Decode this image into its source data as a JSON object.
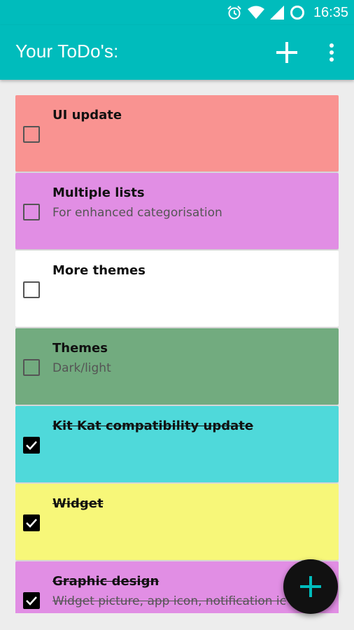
{
  "colors": {
    "primary": "#00bcbc",
    "background": "#ededed",
    "fab": "#111111",
    "fab_icon": "#00bcbc"
  },
  "status_bar": {
    "icons": [
      "alarm-icon",
      "wifi-icon",
      "cell-signal-icon",
      "sync-circle-icon"
    ],
    "time": "16:35"
  },
  "app_bar": {
    "title": "Your ToDo's:",
    "actions": [
      "add-icon",
      "more-vert-icon"
    ]
  },
  "todos": [
    {
      "title": "UI update",
      "subtitle": "",
      "checked": false,
      "color": "#f99391"
    },
    {
      "title": "Multiple lists",
      "subtitle": "For enhanced categorisation",
      "checked": false,
      "color": "#e18ee4"
    },
    {
      "title": "More themes",
      "subtitle": "",
      "checked": false,
      "color": "#ffffff"
    },
    {
      "title": "Themes",
      "subtitle": "Dark/light",
      "checked": false,
      "color": "#72ab7f"
    },
    {
      "title": "Kit Kat compatibility update",
      "subtitle": "",
      "checked": true,
      "color": "#4fd9da"
    },
    {
      "title": "Widget",
      "subtitle": "",
      "checked": true,
      "color": "#f7f779"
    },
    {
      "title": "Graphic design",
      "subtitle": "Widget picture, app icon, notification ic",
      "checked": true,
      "color": "#e18ee4"
    }
  ],
  "fab": {
    "icon": "add-icon"
  }
}
